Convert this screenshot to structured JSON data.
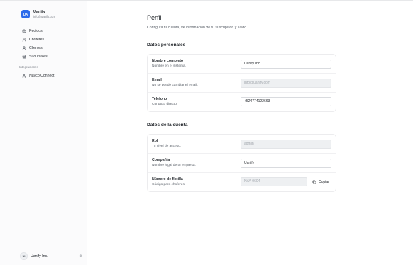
{
  "app": {
    "logo_text": "UA",
    "name": "Uanify",
    "email": "info@uanify.com"
  },
  "sidebar": {
    "items": [
      {
        "label": "Pedidos",
        "icon": "box-icon"
      },
      {
        "label": "Choferes",
        "icon": "user-icon"
      },
      {
        "label": "Clientes",
        "icon": "user-icon"
      },
      {
        "label": "Sucursales",
        "icon": "store-icon"
      }
    ],
    "section_label": "Integraciones",
    "integrations": [
      {
        "label": "Navco Connect",
        "icon": "network-icon"
      }
    ],
    "account": {
      "initials": "UI",
      "name": "Uanify Inc."
    }
  },
  "page": {
    "title": "Perfil",
    "subtitle": "Configura tu cuenta, ve información de tu suscripción y saldo."
  },
  "personal": {
    "title": "Datos personales",
    "fields": {
      "name": {
        "label": "Nombre completo",
        "desc": "Nombre en el sistema.",
        "value": "Uanify Inc."
      },
      "email": {
        "label": "Email",
        "desc": "No se puede cambiar el email.",
        "value": "info@uanify.com"
      },
      "phone": {
        "label": "Telefono",
        "desc": "Contacto directo.",
        "value": "+524774122663"
      }
    }
  },
  "account_data": {
    "title": "Datos de la cuenta",
    "fields": {
      "role": {
        "label": "Rol",
        "desc": "Tu nivel de acceso.",
        "value": "admin"
      },
      "company": {
        "label": "Compañía",
        "desc": "Nombre legal de tu empresa.",
        "value": "Uanify"
      },
      "fleet": {
        "label": "Número de flotilla",
        "desc": "Código para choferes.",
        "value": "NAV-0604",
        "copy_label": "Copiar"
      }
    }
  }
}
